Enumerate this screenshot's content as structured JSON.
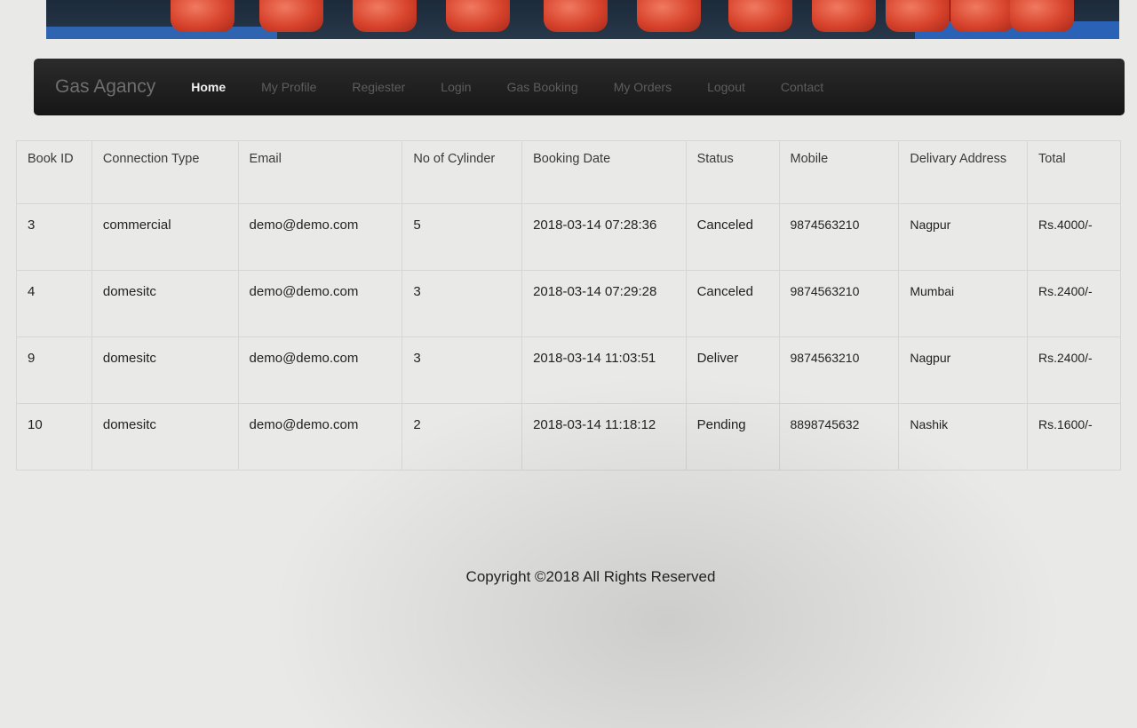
{
  "navbar": {
    "brand": "Gas Agancy",
    "links": [
      "Home",
      "My Profile",
      "Regiester",
      "Login",
      "Gas Booking",
      "My Orders",
      "Logout",
      "Contact"
    ]
  },
  "table": {
    "headers": [
      "Book ID",
      "Connection Type",
      "Email",
      "No of Cylinder",
      "Booking Date",
      "Status",
      "Mobile",
      "Delivary Address",
      "Total"
    ],
    "rows": [
      [
        "3",
        "commercial",
        "demo@demo.com",
        "5",
        "2018-03-14 07:28:36",
        "Canceled",
        "9874563210",
        "Nagpur",
        "Rs.4000/-"
      ],
      [
        "4",
        "domesitc",
        "demo@demo.com",
        "3",
        "2018-03-14 07:29:28",
        "Canceled",
        "9874563210",
        "Mumbai",
        "Rs.2400/-"
      ],
      [
        "9",
        "domesitc",
        "demo@demo.com",
        "3",
        "2018-03-14 11:03:51",
        "Deliver",
        "9874563210",
        "Nagpur",
        "Rs.2400/-"
      ],
      [
        "10",
        "domesitc",
        "demo@demo.com",
        "2",
        "2018-03-14 11:18:12",
        "Pending",
        "8898745632",
        "Nashik",
        "Rs.1600/-"
      ]
    ]
  },
  "footer": {
    "copyright": "Copyright ©2018 All Rights Reserved"
  }
}
